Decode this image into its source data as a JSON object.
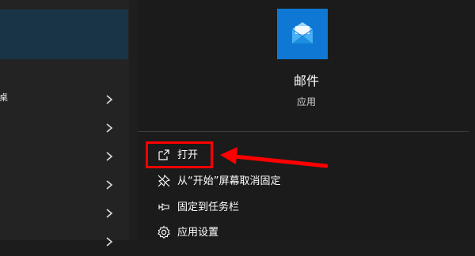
{
  "left": {
    "row_fragment": "桌",
    "chevron_count": 6
  },
  "app": {
    "name": "邮件",
    "type": "应用",
    "tile_color": "#0f78d4",
    "icon": "mail-envelope-icon"
  },
  "menu": [
    {
      "label": "打开",
      "icon": "open-new-window-icon"
    },
    {
      "label": "从“开始”屏幕取消固定",
      "icon": "unpin-icon"
    },
    {
      "label": "固定到任务栏",
      "icon": "pin-taskbar-icon"
    },
    {
      "label": "应用设置",
      "icon": "gear-icon"
    }
  ],
  "annotation": {
    "highlight_color": "#ff0000"
  }
}
